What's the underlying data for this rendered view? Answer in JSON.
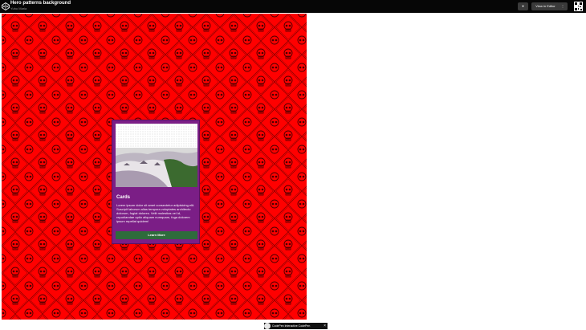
{
  "header": {
    "title": "Hero patterns background",
    "author": "Yuhu Maria",
    "heart_label": "♥",
    "view_editor_label": "View in Editor",
    "more_label": "⋮"
  },
  "card": {
    "title": "Cards",
    "text": "Lorem ipsum dolor sit amet consectetur adipisicing elit. Suscipit laborum alias tempora voluptates architecto dolorum, fugiat dolores. Velit molestias vel id, repudiandae optio aliquam numquam, fuga dolorem ipsum repellat quidem!",
    "button_label": "Learn More"
  },
  "footer": {
    "text": "CodePen Interactive CodePen",
    "close_label": "×"
  },
  "colors": {
    "background": "#ff0000",
    "card": "#7b1e86",
    "button": "#2e6b3c",
    "topbar": "#060606"
  },
  "icons": [
    "codepen-logo-icon",
    "heart-icon",
    "more-icon",
    "qr-code-icon",
    "skull-pattern-icon",
    "close-icon"
  ]
}
